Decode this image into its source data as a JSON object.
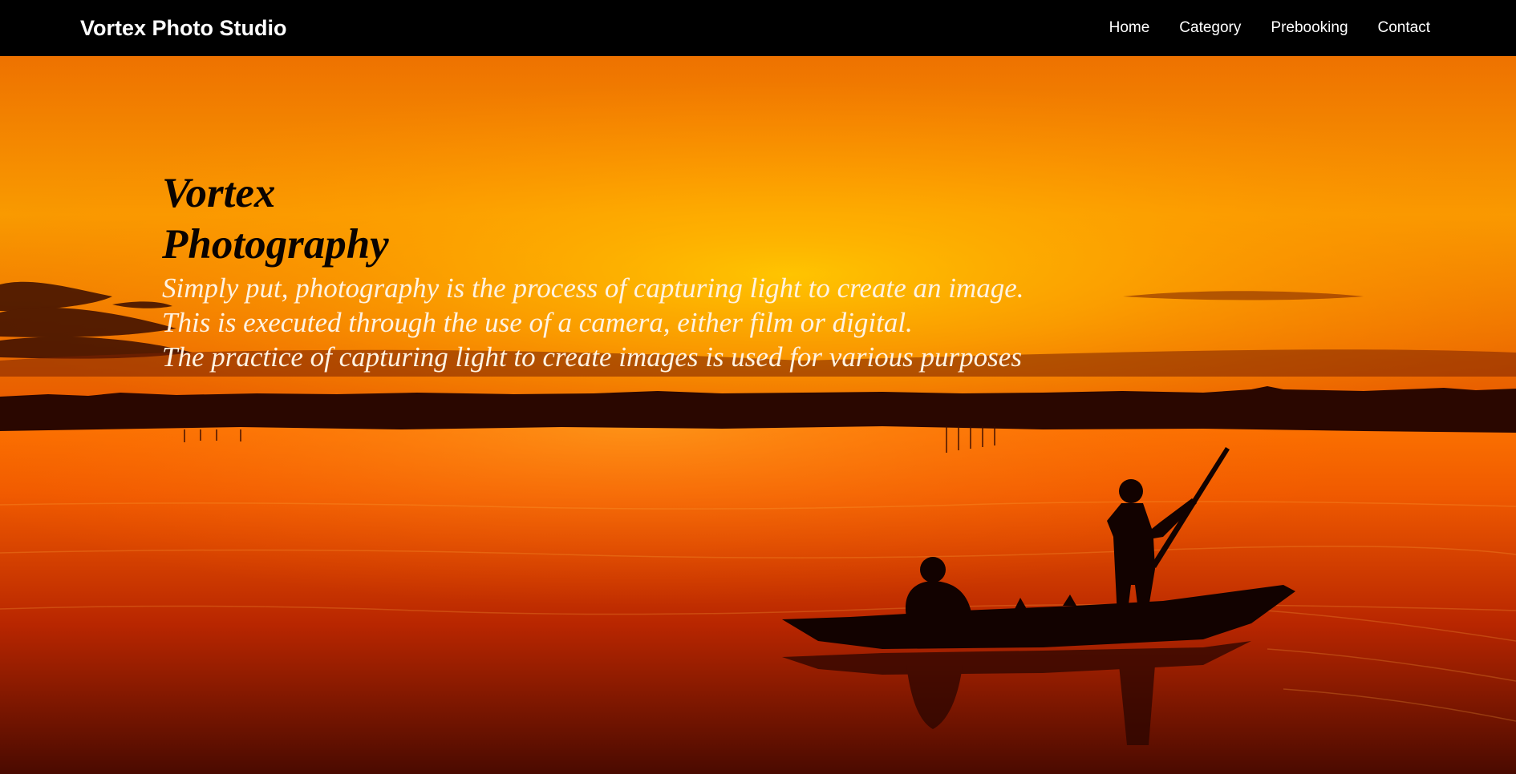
{
  "header": {
    "brand": "Vortex Photo Studio",
    "nav": {
      "home": "Home",
      "category": "Category",
      "prebooking": "Prebooking",
      "contact": "Contact"
    }
  },
  "hero": {
    "title": "Vortex Photography",
    "lines": [
      "Simply put, photography is the process of capturing light to create an image.",
      "This is executed through the use of a camera, either film or digital.",
      "The practice of capturing light to create images is used for various purposes"
    ],
    "image_subject": "sunset-lake-boat-silhouette"
  },
  "colors": {
    "nav_background": "#000000",
    "nav_text": "#ffffff",
    "title_text": "#0a0300",
    "description_text": "#fff3e2",
    "sky_top": "#f07800",
    "sky_glow": "#ffc000",
    "water": "#b82600"
  }
}
